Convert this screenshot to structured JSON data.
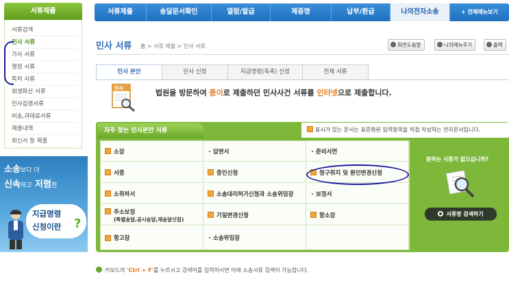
{
  "sidebar": {
    "header": "서류제출",
    "items": [
      {
        "label": "서류검색",
        "active": false
      },
      {
        "label": "민사 서류",
        "active": true
      },
      {
        "label": "가사 서류",
        "active": false
      },
      {
        "label": "행정 서류",
        "active": false
      },
      {
        "label": "특허 서류",
        "active": false
      },
      {
        "label": "회생파산 서류",
        "active": false
      },
      {
        "label": "민사집행서류",
        "active": false
      },
      {
        "label": "비송,과태료서류",
        "active": false
      },
      {
        "label": "제출내역",
        "active": false
      },
      {
        "label": "회신서 등 제출",
        "active": false
      }
    ]
  },
  "promo": {
    "line1_big": "소송",
    "line1_small": "보다 더",
    "line2_a": "신속",
    "line2_b": "하고",
    "line2_c": "저렴",
    "line2_d": "한",
    "bubble1": "지급명령",
    "bubble2": "신청이란",
    "qmark": "?"
  },
  "gnb": {
    "items": [
      {
        "label": "서류제출",
        "active": false
      },
      {
        "label": "송달문서확인",
        "active": false
      },
      {
        "label": "열람/발급",
        "active": false
      },
      {
        "label": "제증명",
        "active": false
      },
      {
        "label": "납부/환급",
        "active": false
      },
      {
        "label": "나의전자소송",
        "active": true
      }
    ],
    "full_menu": "+ 전체메뉴보기"
  },
  "header": {
    "title": "민사 서류",
    "breadcrumb": "홈 > 서류 제출 > 민사 서류",
    "buttons": {
      "help": "화면도움말",
      "add_menu": "나의메뉴추가",
      "print": "출력"
    }
  },
  "tabs": [
    {
      "label": "민사 본안",
      "active": true
    },
    {
      "label": "민사 신청",
      "active": false
    },
    {
      "label": "지급명령(독촉) 신청",
      "active": false
    },
    {
      "label": "전체 서류",
      "active": false
    }
  ],
  "intro": {
    "icon_label": "민사",
    "p1": "법원을 방문하여 ",
    "p2": "종이",
    "p3": "로 제출하던 민사사건 서류를 ",
    "p4": "인터넷",
    "p5": "으로 제출합니다."
  },
  "frequent": {
    "title": "자주 찾는 민사본안 서류",
    "legend": "표시가 있는 문서는 표준화된 입력항목을 직접 작성하는 전자문서입니다.",
    "rows": [
      [
        {
          "label": "소장",
          "icon": "form"
        },
        {
          "label": "답변서",
          "icon": "bullet"
        },
        {
          "label": "준비서면",
          "icon": "bullet"
        }
      ],
      [
        {
          "label": "서증",
          "icon": "form"
        },
        {
          "label": "증인신청",
          "icon": "form"
        },
        {
          "label": "청구취지 및 원인변경신청",
          "icon": "form"
        }
      ],
      [
        {
          "label": "소취하서",
          "icon": "form"
        },
        {
          "label": "소송대리허가신청과 소송위임장",
          "icon": "form"
        },
        {
          "label": "보정서",
          "icon": "bullet"
        }
      ],
      [
        {
          "label": "주소보정",
          "sub": "(특별송달,공시송달,재송달신청)",
          "icon": "form"
        },
        {
          "label": "기일변경신청",
          "icon": "form"
        },
        {
          "label": "항소장",
          "icon": "form"
        }
      ],
      [
        {
          "label": "항고장",
          "icon": "form"
        },
        {
          "label": "소송위임장",
          "icon": "bullet"
        }
      ]
    ],
    "side_question": "원하는 서류가 없으십니까?",
    "search_button": "서류명 검색하기"
  },
  "hint": {
    "p1": "키보드의 ",
    "key": "'Ctrl + F'",
    "p2": "를 누르시고 검색어를 입력하시면 아래 소송서류 검색이 가능합니다."
  }
}
